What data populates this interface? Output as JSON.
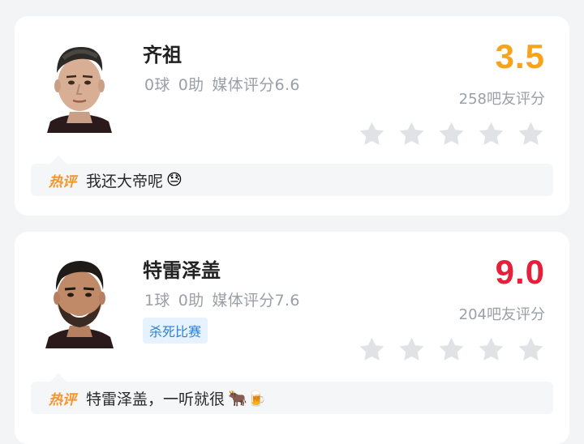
{
  "players": [
    {
      "name": "齐祖",
      "goals": "0球",
      "assists": "0助",
      "media_rating": "媒体评分6.6",
      "tag": "",
      "score": "3.5",
      "score_color": "#f7a41c",
      "fan_rating": "258吧友评分",
      "stars_filled": 0,
      "hot_label": "热评",
      "comment": "我还大帝呢",
      "comment_emoji": "😓"
    },
    {
      "name": "特雷泽盖",
      "goals": "1球",
      "assists": "0助",
      "media_rating": "媒体评分7.6",
      "tag": "杀死比赛",
      "score": "9.0",
      "score_color": "#e5203a",
      "fan_rating": "204吧友评分",
      "stars_filled": 0,
      "hot_label": "热评",
      "comment": "特雷泽盖，一听就很",
      "comment_emoji": "🐂🍺"
    }
  ],
  "star_icon": "star-icon",
  "star_color": "#e0e2e5"
}
